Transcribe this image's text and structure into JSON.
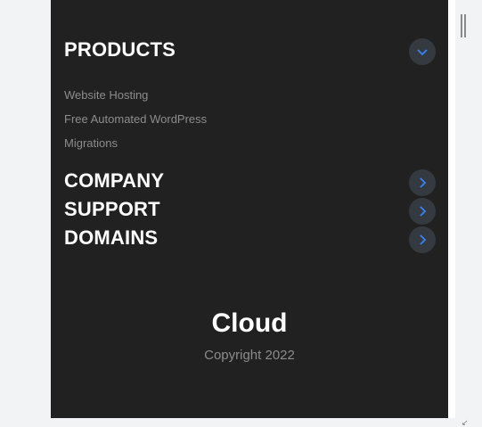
{
  "footer_nav": {
    "products": {
      "title": "PRODUCTS",
      "toggle_icon": "chevron-down-icon",
      "links": [
        "Website Hosting",
        "Free Automated WordPress",
        "Migrations"
      ]
    },
    "company": {
      "title": "COMPANY",
      "toggle_icon": "chevron-right-icon"
    },
    "support": {
      "title": "SUPPORT",
      "toggle_icon": "chevron-right-icon"
    },
    "domains": {
      "title": "DOMAINS",
      "toggle_icon": "chevron-right-icon"
    }
  },
  "footer": {
    "brand": "Cloud",
    "copyright": "Copyright 2022"
  },
  "colors": {
    "panel_bg": "#212121",
    "toggle_bg": "#343a40",
    "chevron": "#3b82f6",
    "muted_text": "#8c8c8c"
  }
}
